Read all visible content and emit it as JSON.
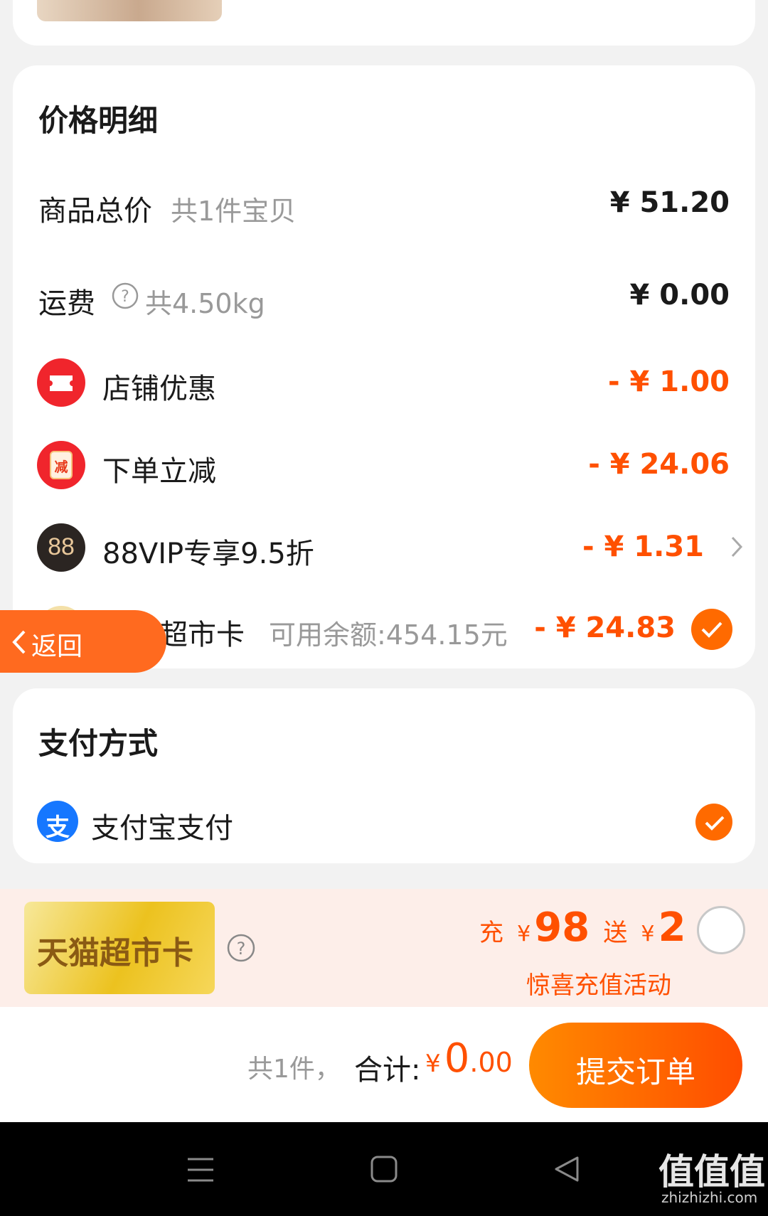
{
  "price_detail": {
    "title": "价格明细",
    "rows": [
      {
        "label": "商品总价",
        "sub": "共1件宝贝",
        "amount": "¥ 51.20"
      },
      {
        "label": "运费",
        "sub": "共4.50kg",
        "amount": "¥ 0.00"
      },
      {
        "label": "店铺优惠",
        "amount": "- ¥ 1.00",
        "icon": "coupon-icon"
      },
      {
        "label": "下单立减",
        "amount": "- ¥ 24.06",
        "icon": "discount-jar-icon",
        "icon_text": "减"
      },
      {
        "label": "88VIP专享9.5折",
        "amount": "- ¥ 1.31",
        "icon": "88vip-icon",
        "icon_text": "88"
      },
      {
        "label": "天猫超市卡",
        "sub": "可用余额:454.15元",
        "amount": "- ¥ 24.83",
        "icon": "tmall-card-icon"
      }
    ]
  },
  "back_button": {
    "label": "返回"
  },
  "payment": {
    "title": "支付方式",
    "method": "支付宝支付",
    "method_icon_text": "支"
  },
  "promo": {
    "card_label": "天猫超市卡",
    "charge_prefix": "充",
    "currency": "¥",
    "charge_amount": "98",
    "gift_prefix": "送",
    "gift_amount": "2",
    "subtitle": "惊喜充值活动"
  },
  "footer": {
    "count_text": "共1件，",
    "total_label": "合计:",
    "currency": "¥",
    "total_int": "0",
    "total_dec": ".00",
    "submit_label": "提交订单"
  },
  "watermark": {
    "main": "值值值",
    "sub": "zhizhizhi.com"
  },
  "colors": {
    "accent": "#ff5000",
    "button_start": "#ff8a00",
    "button_end": "#ff4d00",
    "promo_bg": "#fdeee9"
  }
}
